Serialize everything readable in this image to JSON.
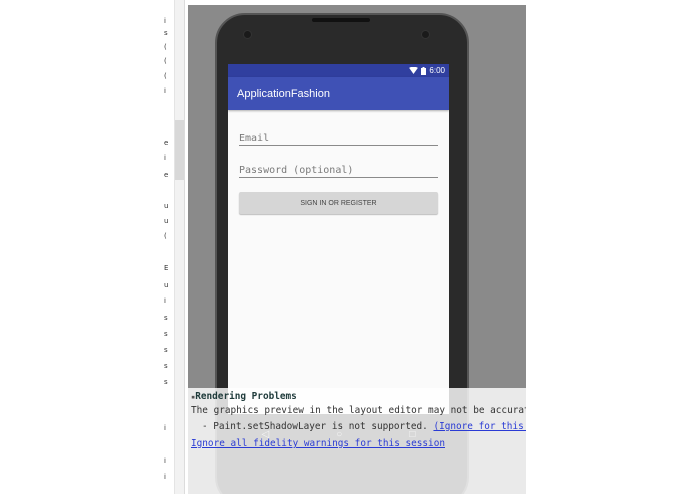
{
  "gutter": {
    "glyphs": [
      "i",
      "s",
      "(",
      "(",
      "(",
      "i",
      "e",
      "i",
      "e",
      "u",
      "u",
      "(",
      "E",
      "u",
      "i",
      "s",
      "s",
      "s",
      "s",
      "s",
      "i",
      "i",
      "i"
    ]
  },
  "device": {
    "status_time": "6:00",
    "app_title": "ApplicationFashion",
    "email_placeholder": "Email",
    "password_placeholder": "Password (optional)",
    "sign_in_label": "SIGN IN OR REGISTER",
    "nav": {
      "back": "◁",
      "home": "○",
      "recents": "□"
    }
  },
  "problems": {
    "title": "Rendering Problems",
    "line1": "The graphics preview in the layout editor may not be accurate:",
    "line2_prefix": "- Paint.setShadowLayer is not supported.",
    "line2_link": "(Ignore for this session)",
    "ignore_all": "Ignore all fidelity warnings for this session"
  },
  "colors": {
    "status_bar": "#303f9f",
    "app_bar": "#3f51b5",
    "link": "#2a3bd4"
  }
}
